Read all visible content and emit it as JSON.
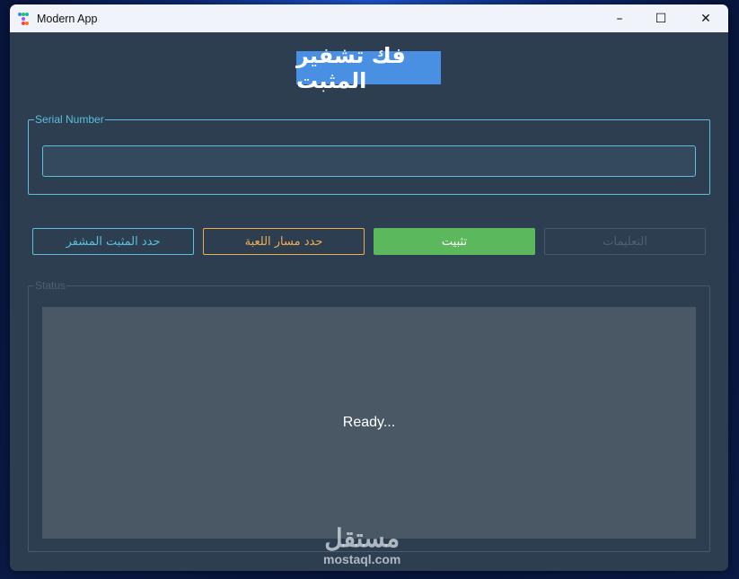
{
  "window": {
    "title": "Modern App",
    "minimize": "–",
    "maximize": "☐",
    "close": "✕"
  },
  "heading": "فك تشفير المثبت",
  "serial": {
    "label": "Serial Number",
    "value": "",
    "placeholder": ""
  },
  "buttons": {
    "select_installer": "حدد المثبت المشفر",
    "select_game_path": "حدد مسار اللعبة",
    "install": "تثبيت",
    "instructions": "التعليمات"
  },
  "status": {
    "label": "Status",
    "text": "Ready..."
  },
  "watermark": {
    "arabic": "مستقل",
    "latin": "mostaql.com"
  },
  "colors": {
    "accent": "#5bc0de",
    "orange": "#f0ad4e",
    "green": "#5cb85c",
    "heading_bg": "#4a90e2",
    "bg": "#2c3e50"
  }
}
